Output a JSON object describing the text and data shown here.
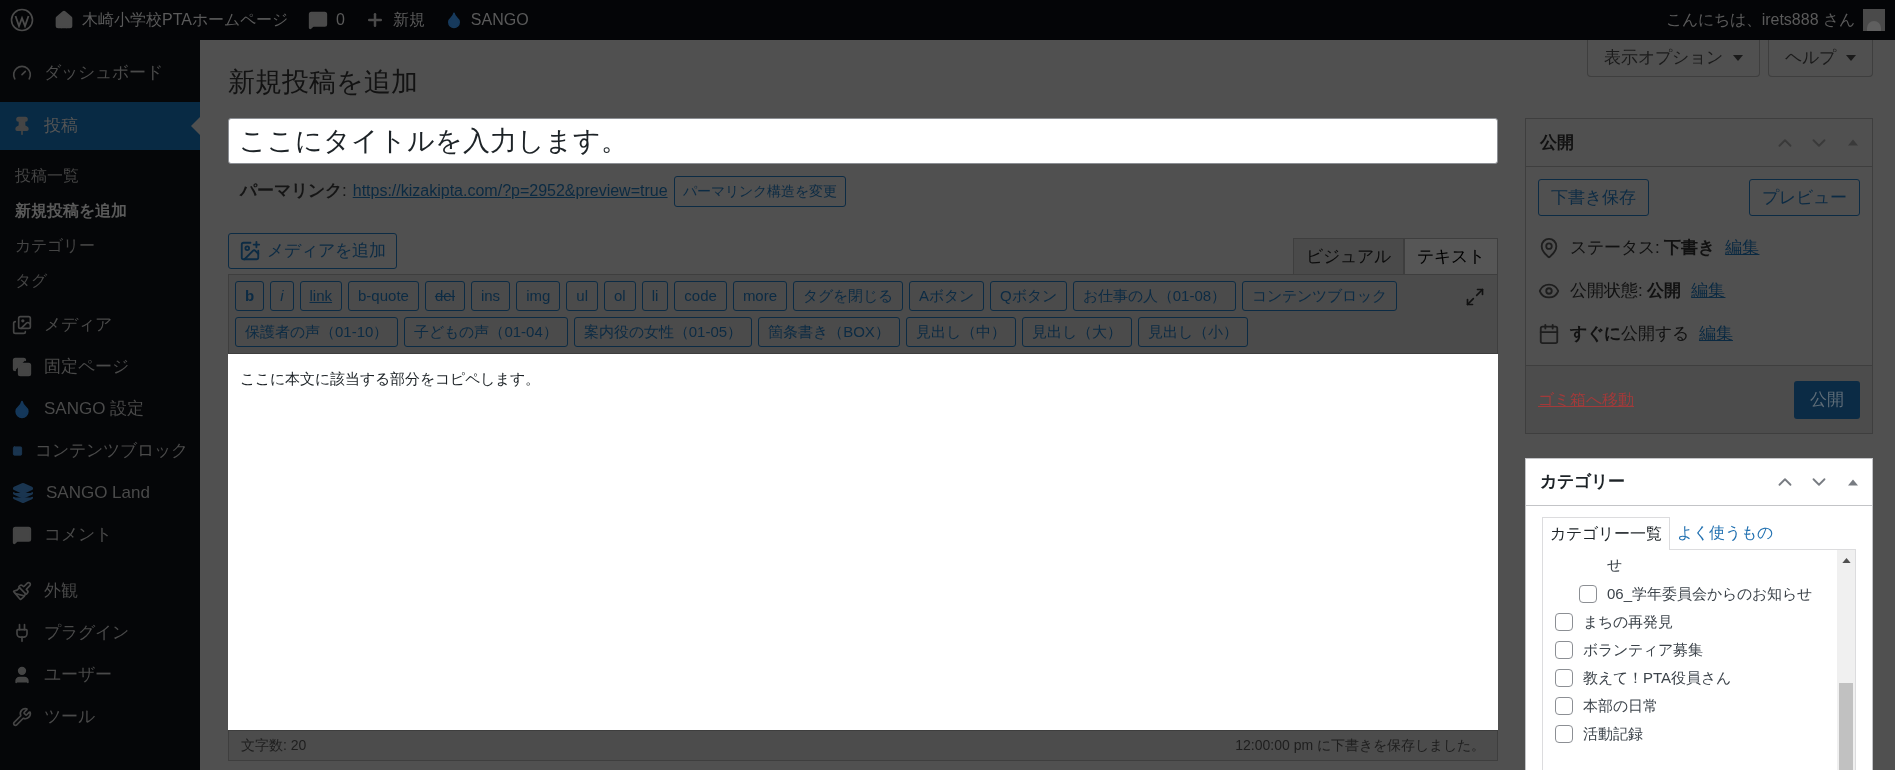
{
  "admin_bar": {
    "items": [
      {
        "kind": "logo"
      },
      {
        "kind": "home",
        "label": "木崎小学校PTAホームページ"
      },
      {
        "kind": "comments",
        "label": "0"
      },
      {
        "kind": "new",
        "label": "新規"
      },
      {
        "kind": "sango",
        "label": "SANGO"
      }
    ],
    "greeting": "こんにちは、irets888 さん"
  },
  "sidebar": {
    "items": [
      {
        "kind": "dashboard",
        "label": "ダッシュボード",
        "selected": false
      },
      {
        "kind": "posts",
        "label": "投稿",
        "selected": true,
        "children": [
          {
            "label": "投稿一覧",
            "selected": false
          },
          {
            "label": "新規投稿を追加",
            "selected": true
          },
          {
            "label": "カテゴリー",
            "selected": false
          },
          {
            "label": "タグ",
            "selected": false
          }
        ]
      },
      {
        "kind": "media",
        "label": "メディア",
        "selected": false
      },
      {
        "kind": "pages",
        "label": "固定ページ",
        "selected": false
      },
      {
        "kind": "sango",
        "label": "SANGO 設定",
        "selected": false
      },
      {
        "kind": "blocks",
        "label": "コンテンツブロック",
        "selected": false
      },
      {
        "kind": "land",
        "label": "SANGO Land",
        "selected": false
      },
      {
        "kind": "comments",
        "label": "コメント",
        "selected": false
      },
      {
        "kind": "appearance",
        "label": "外観",
        "selected": false
      },
      {
        "kind": "plugins",
        "label": "プラグイン",
        "selected": false
      },
      {
        "kind": "users",
        "label": "ユーザー",
        "selected": false
      },
      {
        "kind": "tools",
        "label": "ツール",
        "selected": false
      }
    ]
  },
  "screen_buttons": [
    "表示オプション",
    "ヘルプ"
  ],
  "page_title": "新規投稿を追加",
  "post_title": "ここにタイトルを入力します。",
  "permalink": {
    "label": "**パーマリンク**:",
    "url": "https://kizakipta.com/?p=2952&preview=true",
    "button": "パーマリンク構造を変更"
  },
  "add_media": "メディアを追加",
  "editor_tabs": [
    {
      "label": "ビジュアル",
      "selected": false
    },
    {
      "label": "テキスト",
      "selected": true
    }
  ],
  "quicktags": [
    [
      {
        "label": "b",
        "kind": "bold"
      },
      {
        "label": "i",
        "kind": "italic"
      },
      {
        "label": "link",
        "kind": "link"
      },
      {
        "label": "b-quote",
        "kind": "plain"
      },
      {
        "label": "del",
        "kind": "strike"
      },
      {
        "label": "ins",
        "kind": "plain"
      },
      {
        "label": "img",
        "kind": "plain"
      },
      {
        "label": "ul",
        "kind": "plain"
      },
      {
        "label": "ol",
        "kind": "plain"
      },
      {
        "label": "li",
        "kind": "plain"
      },
      {
        "label": "code",
        "kind": "plain"
      },
      {
        "label": "more",
        "kind": "plain"
      },
      {
        "label": "タグを閉じる",
        "kind": "plain"
      },
      {
        "label": "Aボタン",
        "kind": "plain"
      },
      {
        "label": "Qボタン",
        "kind": "plain"
      },
      {
        "label": "お仕事の人（01-08）",
        "kind": "plain"
      },
      {
        "label": "コンテンツブロック",
        "kind": "plain"
      }
    ],
    [
      {
        "label": "保護者の声（01-10）",
        "kind": "plain"
      },
      {
        "label": "子どもの声（01-04）",
        "kind": "plain"
      },
      {
        "label": "案内役の女性（01-05）",
        "kind": "plain"
      },
      {
        "label": "箇条書き（BOX）",
        "kind": "plain"
      },
      {
        "label": "見出し（中）",
        "kind": "plain"
      },
      {
        "label": "見出し（大）",
        "kind": "plain"
      },
      {
        "label": "見出し（小）",
        "kind": "plain"
      }
    ]
  ],
  "body": "ここに本文に該当する部分をコピペします。",
  "word_count": "文字数: 20",
  "autosave": "12:00:00 pm に下書きを保存しました。",
  "publish": {
    "title": "公開",
    "save_draft": "下書き保存",
    "preview": "プレビュー",
    "rows": [
      {
        "kind": "status",
        "text": "ステータス: **下書き**",
        "link": "編集"
      },
      {
        "kind": "visibility",
        "text": "公開状態: **公開**",
        "link": "編集"
      },
      {
        "kind": "schedule",
        "text": "**すぐに**公開する",
        "link": "編集"
      }
    ],
    "trash": "ゴミ箱へ移動",
    "button": "公開"
  },
  "categories": {
    "title": "カテゴリー",
    "tabs": [
      {
        "label": "カテゴリー一覧",
        "selected": true
      },
      {
        "label": "よく使うもの",
        "selected": false
      }
    ],
    "items": [
      {
        "children": [
          {
            "kind": "continuation",
            "label": "せ"
          },
          {
            "kind": "checkbox",
            "label": "06_学年委員会からのお知らせ",
            "checked": false
          }
        ]
      },
      {
        "kind": "checkbox",
        "label": "まちの再発見",
        "checked": false
      },
      {
        "kind": "checkbox",
        "label": "ボランティア募集",
        "checked": false
      },
      {
        "kind": "checkbox",
        "label": "教えて！PTA役員さん",
        "checked": false
      },
      {
        "kind": "checkbox",
        "label": "本部の日常",
        "checked": false
      },
      {
        "kind": "checkbox",
        "label": "活動記録",
        "checked": false
      }
    ]
  }
}
